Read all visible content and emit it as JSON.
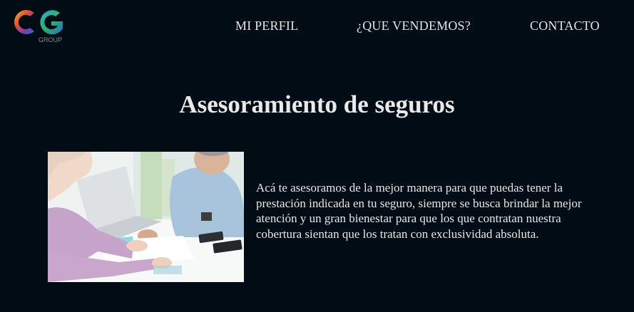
{
  "brand": {
    "logo_letters": "CG",
    "logo_subtext": "GROUP"
  },
  "nav": {
    "items": [
      {
        "label": "MI PERFIL"
      },
      {
        "label": "¿QUE VENDEMOS?"
      },
      {
        "label": "CONTACTO"
      }
    ]
  },
  "main": {
    "title": "Asesoramiento de seguros",
    "description": "Acá te asesoramos de la mejor manera para que puedas tener la prestación indicada en tu seguro, siempre se busca brindar la mejor atención y un gran bienestar para que los que contratan nuestra cobertura sientan que los tratan con exclusividad absoluta.",
    "image_alt": "insurance-consultation-photo"
  },
  "colors": {
    "background": "#020c15",
    "text": "#e8e8e8"
  }
}
